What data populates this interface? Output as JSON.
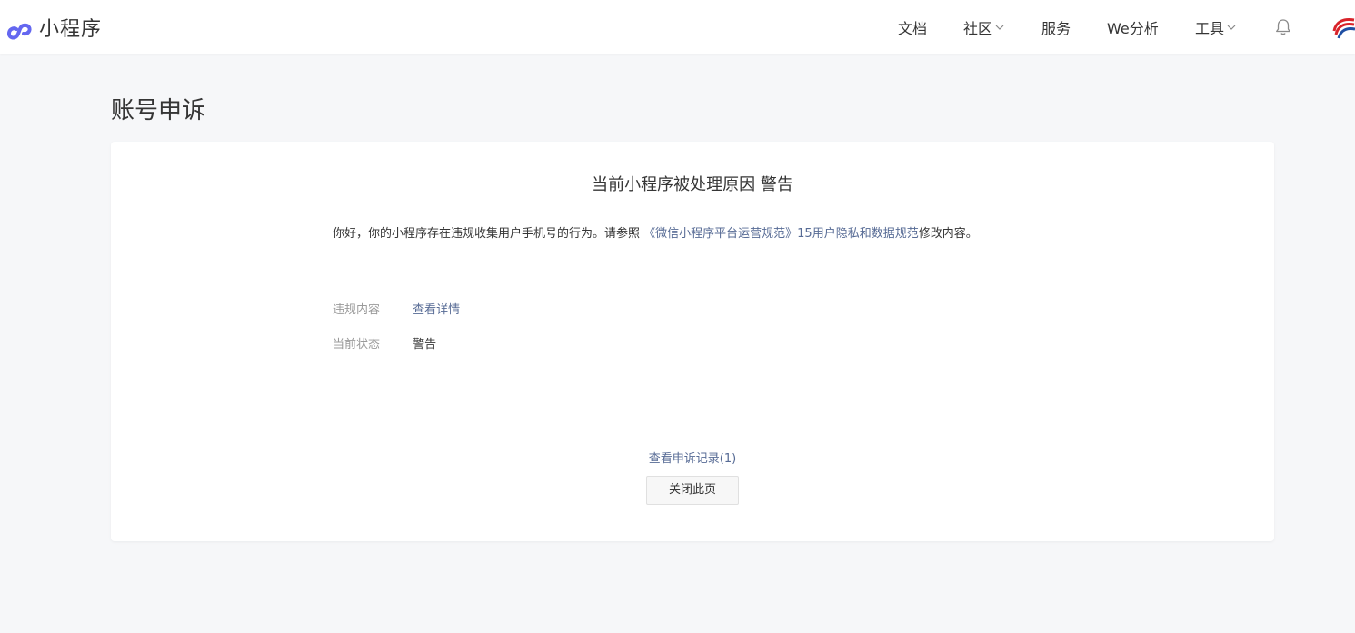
{
  "header": {
    "logo_text": "小程序",
    "nav": {
      "docs": "文档",
      "community": "社区",
      "services": "服务",
      "analytics": "We分析",
      "tools": "工具"
    }
  },
  "page": {
    "title": "账号申诉"
  },
  "card": {
    "reason_title": "当前小程序被处理原因 警告",
    "notice_prefix": "你好，你的小程序存在违规收集用户手机号的行为。请参照",
    "notice_link": "《微信小程序平台运营规范》15用户隐私和数据规范",
    "notice_suffix": "修改内容。",
    "violation_label": "违规内容",
    "violation_link": "查看详情",
    "status_label": "当前状态",
    "status_value": "警告",
    "records_link": "查看申诉记录(1)",
    "close_button": "关闭此页"
  },
  "colors": {
    "link": "#576b95",
    "logo_accent": "#6467f0",
    "background": "#f6f7f9"
  },
  "icons": [
    "mini-program-logo-icon",
    "chevron-down-icon",
    "bell-icon",
    "avatar"
  ]
}
